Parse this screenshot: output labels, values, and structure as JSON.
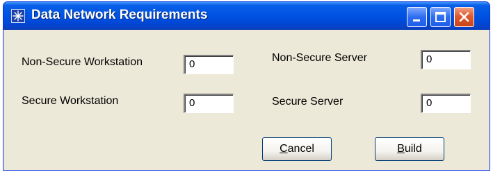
{
  "window": {
    "title": "Data Network Requirements",
    "icon": "star-burst-icon",
    "controls": [
      "minimize-icon",
      "maximize-icon",
      "close-icon"
    ]
  },
  "fields": {
    "non_secure_workstation": {
      "label": "Non-Secure Workstation",
      "value": "0"
    },
    "non_secure_server": {
      "label": "Non-Secure Server",
      "value": "0"
    },
    "secure_workstation": {
      "label": "Secure Workstation",
      "value": "0"
    },
    "secure_server": {
      "label": "Secure Server",
      "value": "0"
    }
  },
  "buttons": {
    "cancel": "Cancel",
    "build": "Build"
  },
  "colors": {
    "titlebar": "#0054e3",
    "window_face": "#ece9d8",
    "close_button": "#e05a30"
  }
}
